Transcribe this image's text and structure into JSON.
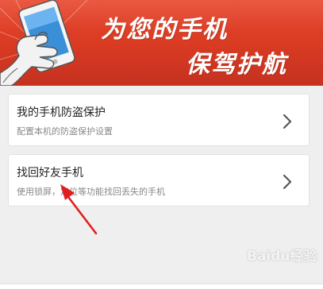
{
  "banner": {
    "slogan_line1": "为您的手机",
    "slogan_line2": "保驾护航",
    "background_color": "#d83a22"
  },
  "menu": {
    "items": [
      {
        "title": "我的手机防盗保护",
        "subtitle": "配置本机的防盗保护设置",
        "icon": "chevron-right-icon"
      },
      {
        "title": "找回好友手机",
        "subtitle": "使用锁屏，定位等功能找回丢失的手机",
        "icon": "chevron-right-icon"
      }
    ]
  },
  "annotation": {
    "arrow_color": "#e02020"
  },
  "watermark": {
    "text": "Baidu经验"
  }
}
